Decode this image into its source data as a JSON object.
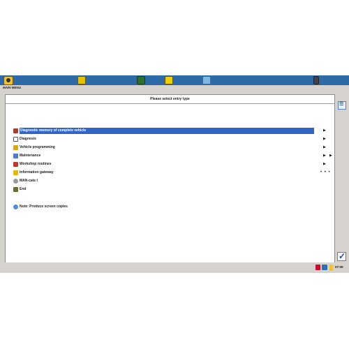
{
  "menu": {
    "title": "MAIN MENU"
  },
  "header": {
    "title": "Please select entry type"
  },
  "rows": [
    {
      "label": "Diagnostic memory of complete vehicle",
      "suffix": "▶",
      "selected": true,
      "icon": "diagnostic-memory-icon",
      "color": "#b03a2e"
    },
    {
      "label": "Diagnosis",
      "suffix": "▶",
      "icon": "diagnosis-icon",
      "color": "#ffffff"
    },
    {
      "label": "Vehicle programming",
      "suffix": "▶",
      "icon": "vehicle-programming-icon",
      "color": "#e0a800"
    },
    {
      "label": "Maintenance",
      "suffix": "▶",
      "suffix2": "▶",
      "icon": "maintenance-icon",
      "color": "#4a7bd0"
    },
    {
      "label": "Workshop routines",
      "suffix": "▶",
      "icon": "workshop-routines-icon",
      "color": "#c0392b"
    },
    {
      "label": "Information gateway",
      "suffix": "• • •",
      "icon": "information-gateway-icon",
      "color": "#e6b800"
    },
    {
      "label": "MAN-cats I",
      "icon": "man-cats-icon",
      "color": "#9a9a9a"
    },
    {
      "label": "End",
      "icon": "end-icon",
      "color": "#6b6b2a"
    },
    {
      "label": "Note: Produce screen copies",
      "icon": "note-icon",
      "color": "#4a90d9"
    }
  ],
  "status": {
    "time": "07:09"
  }
}
